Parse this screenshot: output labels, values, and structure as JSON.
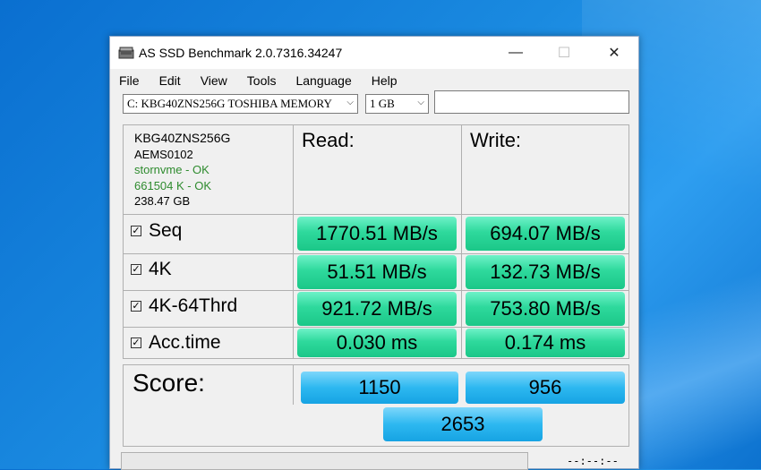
{
  "window": {
    "title": "AS SSD Benchmark 2.0.7316.34247",
    "min_glyph": "—",
    "max_glyph": "☐",
    "close_glyph": "✕"
  },
  "menu": [
    "File",
    "Edit",
    "View",
    "Tools",
    "Language",
    "Help"
  ],
  "toolbar": {
    "drive_value": "C: KBG40ZNS256G TOSHIBA MEMORY",
    "size_value": "1 GB",
    "text_value": ""
  },
  "info": {
    "model": "KBG40ZNS256G",
    "firmware": "AEMS0102",
    "driver": "stornvme - OK",
    "alignment": "661504 K - OK",
    "capacity": "238.47 GB"
  },
  "headers": {
    "read": "Read:",
    "write": "Write:"
  },
  "rows": [
    {
      "label": "Seq",
      "read": "1770.51 MB/s",
      "write": "694.07 MB/s"
    },
    {
      "label": "4K",
      "read": "51.51 MB/s",
      "write": "132.73 MB/s"
    },
    {
      "label": "4K-64Thrd",
      "read": "921.72 MB/s",
      "write": "753.80 MB/s"
    },
    {
      "label": "Acc.time",
      "read": "0.030 ms",
      "write": "0.174 ms"
    }
  ],
  "score": {
    "label": "Score:",
    "read": "1150",
    "write": "956",
    "total": "2653"
  },
  "status": {
    "timer": "--:--:--"
  },
  "colors": {
    "result_green": "#2ed99c",
    "score_blue": "#2db8f0",
    "ok_green": "#2e8b2e"
  }
}
